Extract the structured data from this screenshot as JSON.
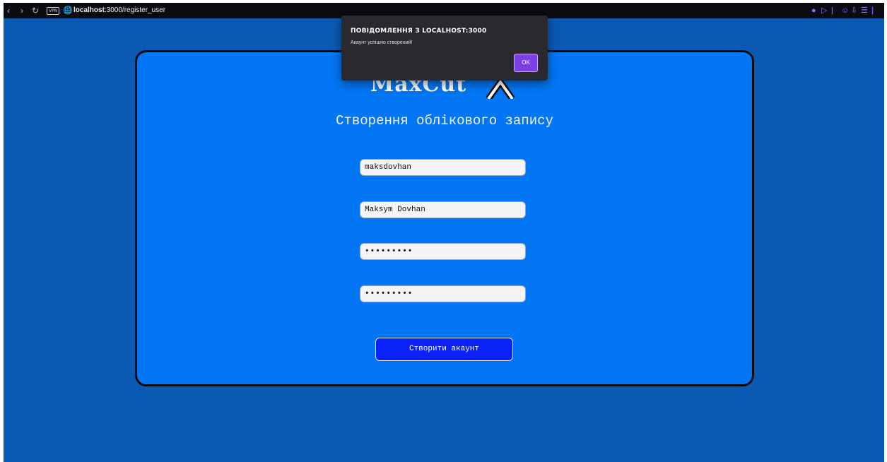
{
  "browser": {
    "vpn_label": "VPN",
    "url_host": "localhost",
    "url_rest": ":3000/register_user",
    "icons": [
      "back-icon",
      "forward-icon",
      "reload-icon",
      "globe-icon",
      "shield-icon",
      "play-icon",
      "account-icon",
      "download-icon",
      "menu-icon"
    ]
  },
  "page": {
    "logo_text": "MaxCut",
    "subtitle": "Створення облікового запису",
    "fields": {
      "username": "maksdovhan",
      "fullname": "Maksym Dovhan",
      "password": "•••••••••",
      "password_confirm": "•••••••••"
    },
    "create_button": "Створити акаунт"
  },
  "alert": {
    "title": "ПОВІДОМЛЕННЯ З LOCALHOST:3000",
    "message": "Акаунт успішно створений!",
    "ok_label": "OK"
  },
  "colors": {
    "page_bg": "#0a5ab4",
    "card_bg": "#0276f4",
    "button_bg": "#0a22f5",
    "ok_button": "#7b3fe4"
  }
}
